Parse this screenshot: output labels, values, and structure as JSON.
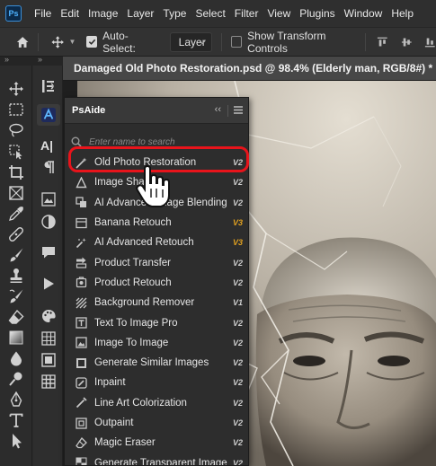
{
  "app": {
    "logo": "Ps"
  },
  "menubar": {
    "items": [
      "File",
      "Edit",
      "Image",
      "Layer",
      "Type",
      "Select",
      "Filter",
      "View",
      "Plugins",
      "Window",
      "Help"
    ]
  },
  "options": {
    "auto_select_label": "Auto-Select:",
    "auto_select_checked": true,
    "target_value": "Layer",
    "show_transform_label": "Show Transform Controls",
    "show_transform_checked": false
  },
  "document": {
    "tab_title": "Damaged Old Photo Restoration.psd @ 98.4% (Elderly man, RGB/8#) *"
  },
  "panel": {
    "title": "PsAide",
    "search_placeholder": "Enter name to search",
    "items": [
      {
        "label": "Old Photo Restoration",
        "version": "V2",
        "icon": "magic-wand-icon"
      },
      {
        "label": "Image Sharpen",
        "version": "V2",
        "icon": "sharpen-icon"
      },
      {
        "label": "AI Advanced Image Blending",
        "version": "V2",
        "icon": "blend-icon"
      },
      {
        "label": "Banana Retouch",
        "version": "V3",
        "icon": "banana-icon"
      },
      {
        "label": "AI Advanced Retouch",
        "version": "V3",
        "icon": "sparkle-icon"
      },
      {
        "label": "Product Transfer",
        "version": "V2",
        "icon": "transfer-icon"
      },
      {
        "label": "Product Retouch",
        "version": "V2",
        "icon": "retouch-icon"
      },
      {
        "label": "Background Remover",
        "version": "V1",
        "icon": "background-remove-icon"
      },
      {
        "label": "Text To Image Pro",
        "version": "V2",
        "icon": "text-image-icon"
      },
      {
        "label": "Image To Image",
        "version": "V2",
        "icon": "image-to-image-icon"
      },
      {
        "label": "Generate Similar Images",
        "version": "V2",
        "icon": "similar-images-icon"
      },
      {
        "label": "Inpaint",
        "version": "V2",
        "icon": "inpaint-icon"
      },
      {
        "label": "Line Art Colorization",
        "version": "V2",
        "icon": "colorize-icon"
      },
      {
        "label": "Outpaint",
        "version": "V2",
        "icon": "outpaint-icon"
      },
      {
        "label": "Magic Eraser",
        "version": "V2",
        "icon": "eraser-icon"
      },
      {
        "label": "Generate Transparent Image",
        "version": "V2",
        "icon": "transparent-icon"
      }
    ]
  },
  "colors": {
    "highlight": "#e8141b",
    "version_v3": "#e0a020",
    "accent": "#3a8fd9"
  }
}
